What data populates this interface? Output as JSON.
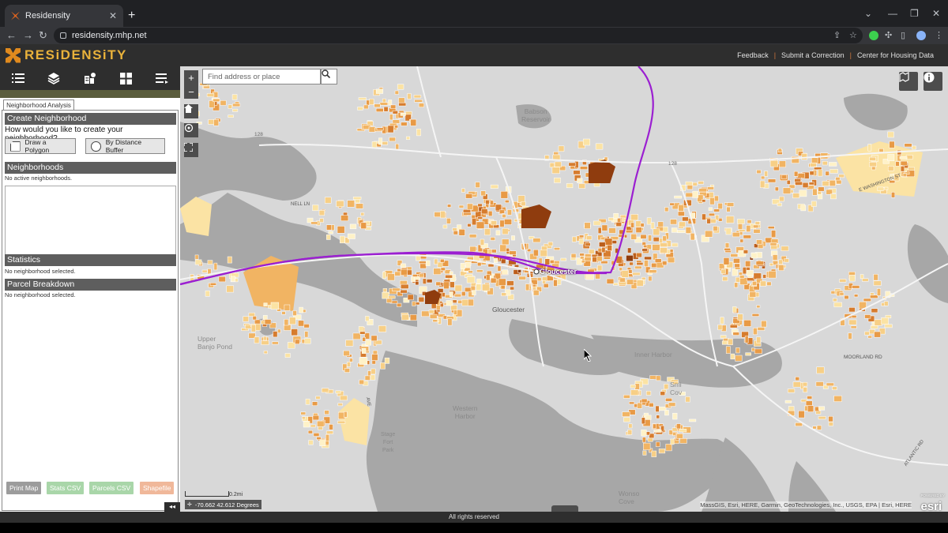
{
  "browser": {
    "tab_title": "Residensity",
    "tab_close": "✕",
    "new_tab": "+",
    "url": "residensity.mhp.net"
  },
  "header": {
    "logo_text": "RESiDENSiTY",
    "links": [
      "Feedback",
      "Submit a Correction",
      "Center for Housing Data"
    ],
    "separator": "|"
  },
  "sidebar": {
    "tools": [
      "list-icon",
      "layers-icon",
      "building-chart-icon",
      "grid-icon",
      "legend-list-icon"
    ],
    "tab_label": "Neighborhood Analysis",
    "create": {
      "title": "Create Neighborhood",
      "question": "How would you like to create your neighborhood?",
      "polygon_label": "Draw a Polygon",
      "buffer_label": "By Distance Buffer"
    },
    "neighborhoods": {
      "title": "Neighborhoods",
      "empty": "No active neighborhoods."
    },
    "statistics": {
      "title": "Statistics",
      "empty": "No neighborhood selected."
    },
    "parcel_breakdown": {
      "title": "Parcel Breakdown",
      "empty": "No neighborhood selected."
    },
    "exports": [
      {
        "label": "Print Map",
        "color": "#9c9c9c"
      },
      {
        "label": "Stats CSV",
        "color": "#a9d6a9"
      },
      {
        "label": "Parcels CSV",
        "color": "#a9d6a9"
      },
      {
        "label": "Shapefile",
        "color": "#f0b89a"
      }
    ],
    "collapse_label": "◂◂"
  },
  "map": {
    "search_placeholder": "Find address or place",
    "zoom_in": "+",
    "zoom_out": "−",
    "labels": {
      "gloucester_station": "Gloucester",
      "gloucester_city": "Gloucester",
      "babson": "Babson\nReservoir",
      "upper_banjo": "Upper\nBanjo Pond",
      "western_harbor": "Western\nHarbor",
      "inner_harbor": "Inner Harbor",
      "stage_fort": "Stage\nFort\nPark",
      "smith_cove": "Smi\nCov",
      "wonson_cove": "Wonso\nCove",
      "route_128a": "128",
      "route_128b": "128",
      "moorland": "MOORLAND RD",
      "atlantic": "ATLANTIC RD",
      "nell_lane": "NELL LN",
      "washington": "E WASHINGTON ST",
      "ave": "AVE"
    },
    "scale_label": "0.2mi",
    "coordinates": "-70.662 42.612 Degrees",
    "attribution": "MassGIS, Esri, HERE, Garmin, GeoTechnologies, Inc., USGS, EPA | Esri, HERE",
    "esri_tag": "POWERED BY",
    "esri_logo": "esri"
  },
  "footer": {
    "text": "All rights reserved"
  }
}
